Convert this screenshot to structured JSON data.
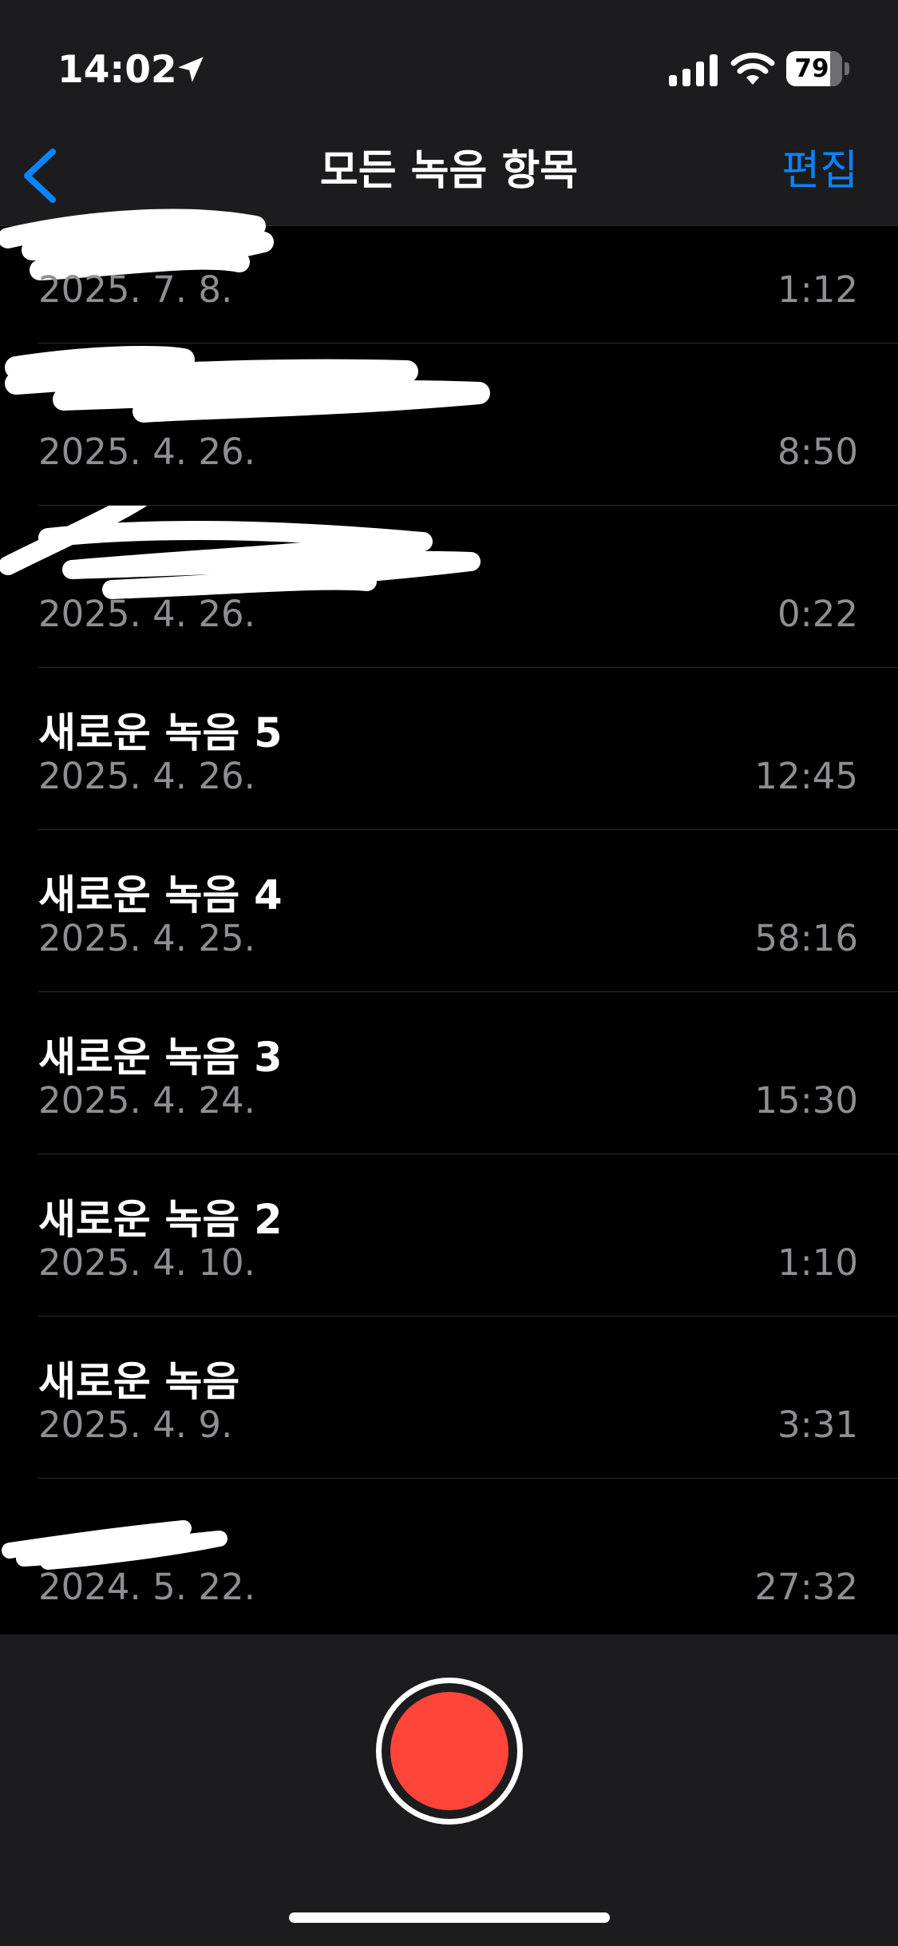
{
  "status_bar": {
    "time": "14:02",
    "battery": "79"
  },
  "nav": {
    "title": "모든 녹음 항목",
    "edit_label": "편집"
  },
  "recordings": [
    {
      "title": "",
      "date": "2025. 7. 8.",
      "duration": "1:12"
    },
    {
      "title": "",
      "date": "2025. 4. 26.",
      "duration": "8:50"
    },
    {
      "title": "",
      "date": "2025. 4. 26.",
      "duration": "0:22"
    },
    {
      "title": "새로운 녹음 5",
      "date": "2025. 4. 26.",
      "duration": "12:45"
    },
    {
      "title": "새로운 녹음 4",
      "date": "2025. 4. 25.",
      "duration": "58:16"
    },
    {
      "title": "새로운 녹음 3",
      "date": "2025. 4. 24.",
      "duration": "15:30"
    },
    {
      "title": "새로운 녹음 2",
      "date": "2025. 4. 10.",
      "duration": "1:10"
    },
    {
      "title": "새로운 녹음",
      "date": "2025. 4. 9.",
      "duration": "3:31"
    },
    {
      "title": "",
      "date": "2024. 5. 22.",
      "duration": "27:32"
    }
  ],
  "colors": {
    "accent": "#0a84ff",
    "record": "#ff453a",
    "secondary_text": "#8e8e93"
  }
}
